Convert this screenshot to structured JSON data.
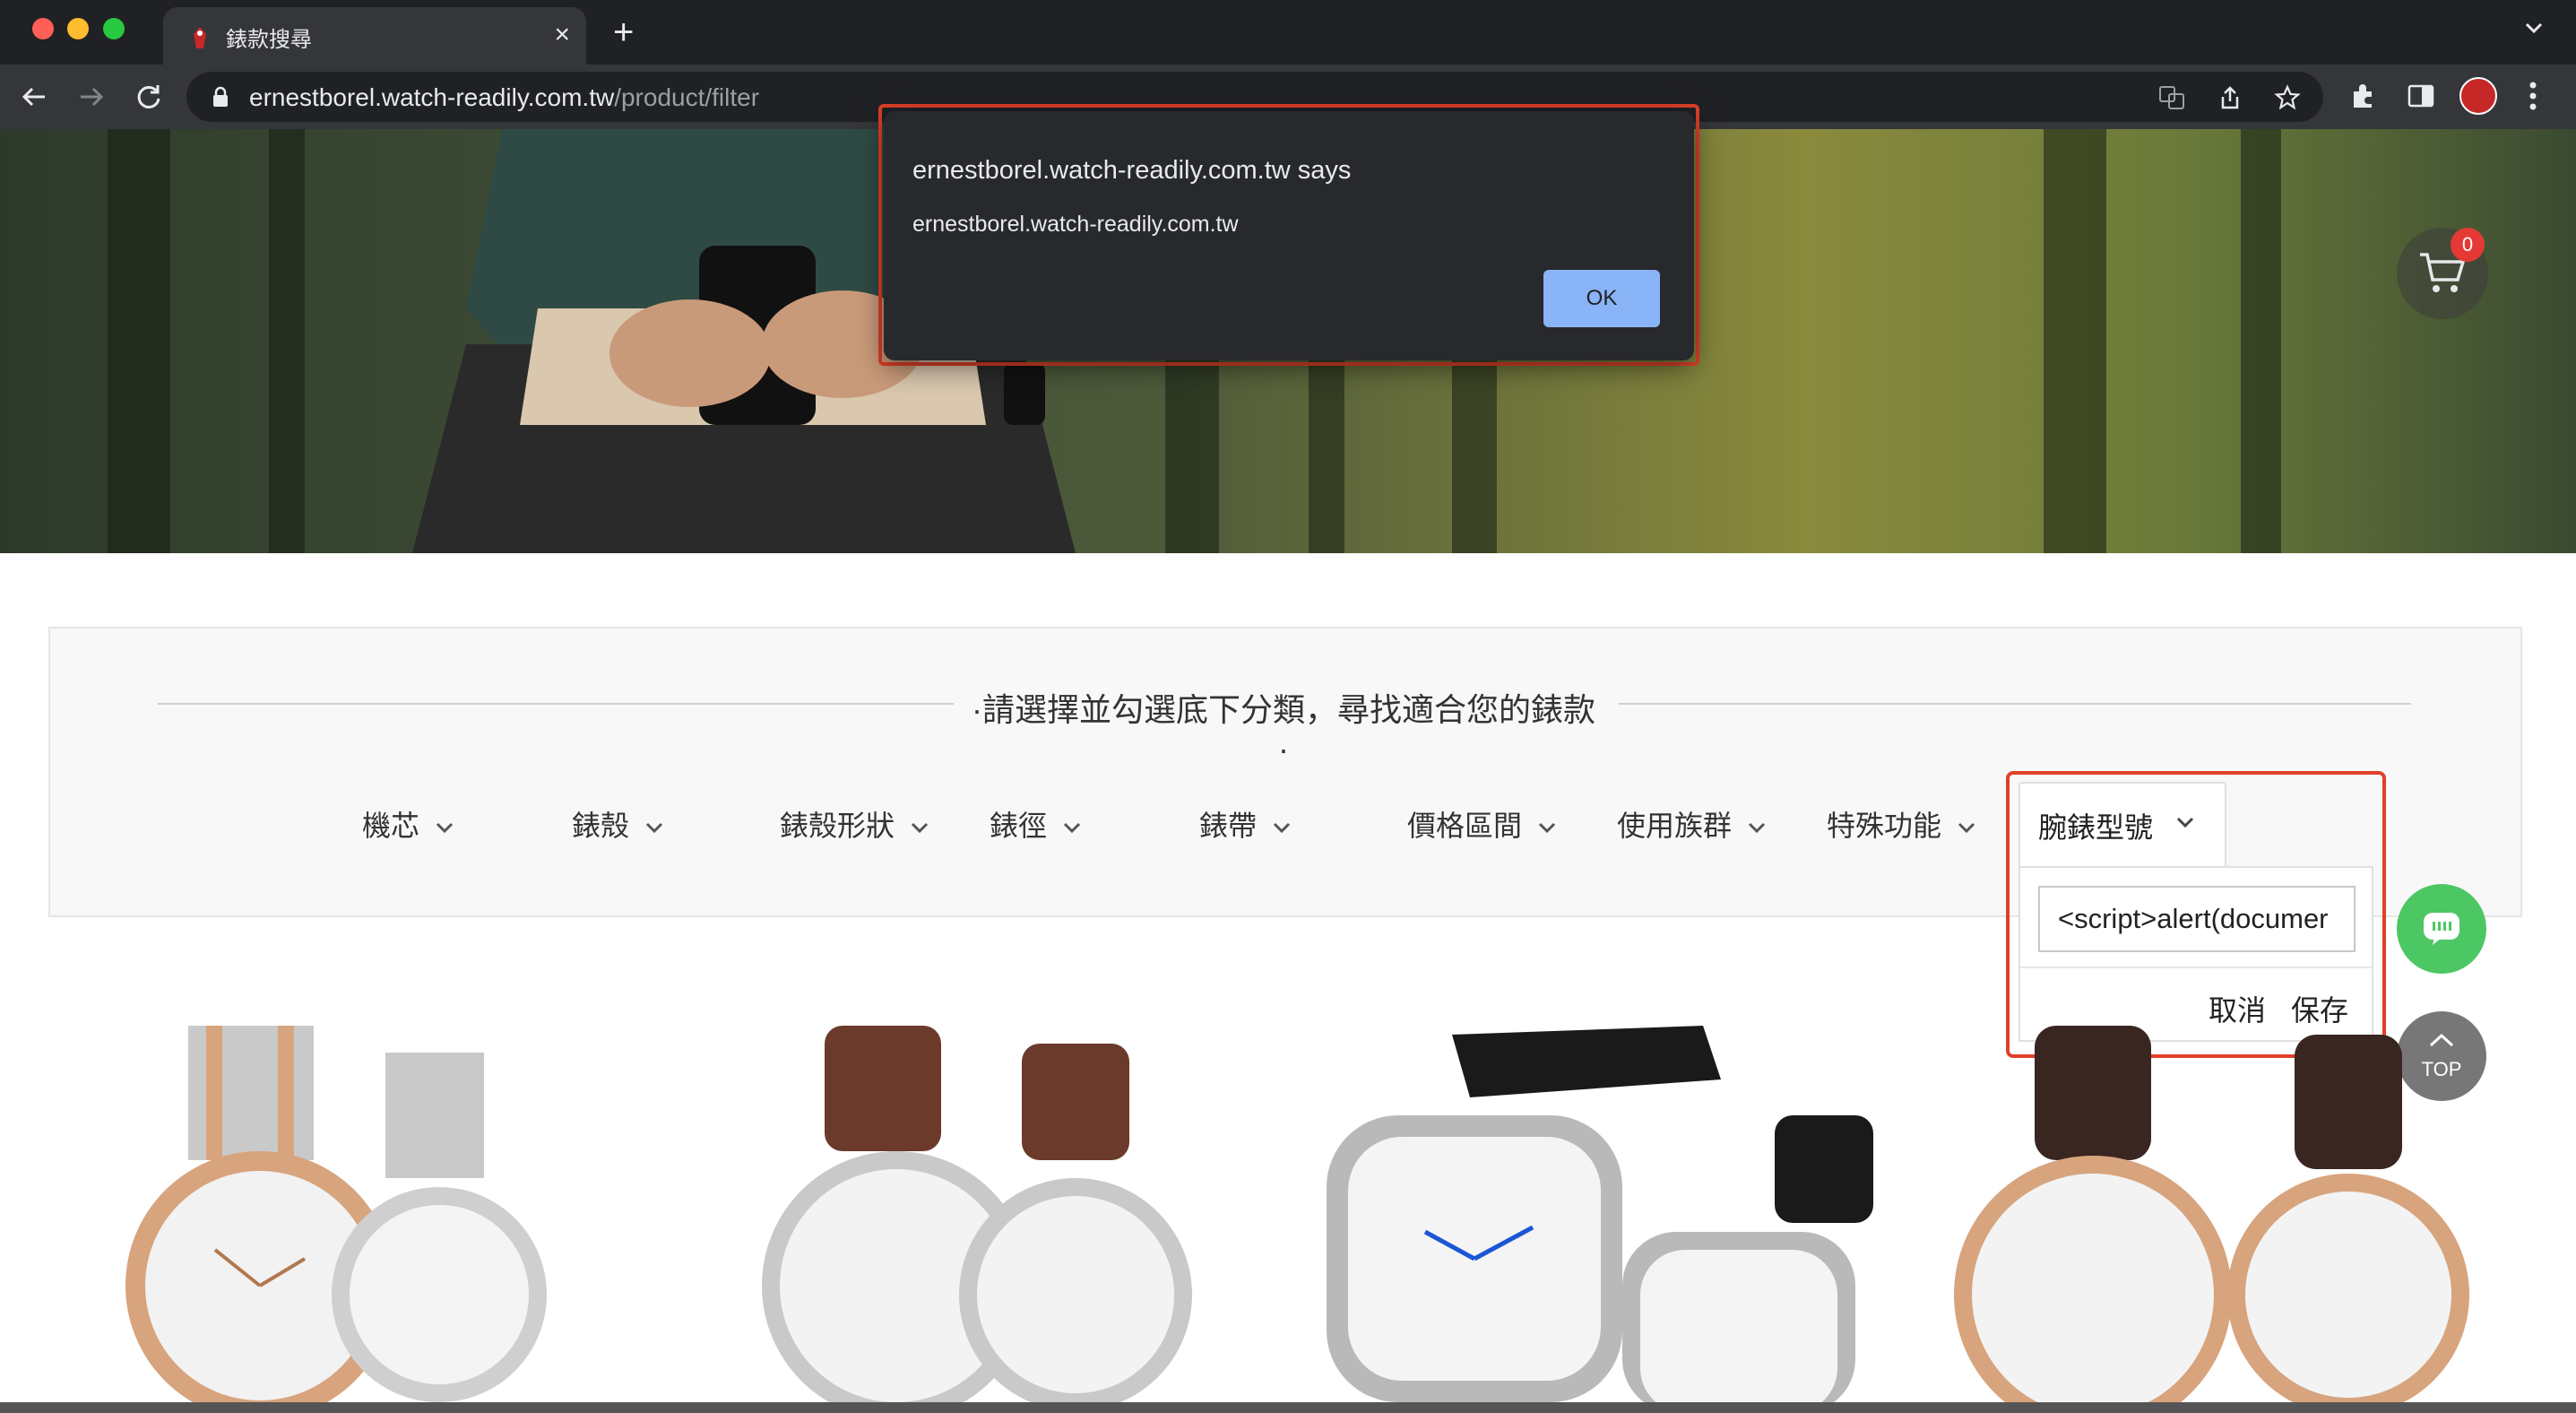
{
  "browser": {
    "tab_title": "錶款搜尋",
    "tab_close": "×",
    "new_tab": "+",
    "url_host": "ernestborel.watch-readily.com.tw",
    "url_path": "/product/filter"
  },
  "alert": {
    "title": "ernestborel.watch-readily.com.tw says",
    "message": "ernestborel.watch-readily.com.tw",
    "ok_label": "OK"
  },
  "cart": {
    "count": "0"
  },
  "filter": {
    "title": "·請選擇並勾選底下分類，尋找適合您的錶款·",
    "items": [
      {
        "label": "機芯"
      },
      {
        "label": "錶殼"
      },
      {
        "label": "錶殼形狀"
      },
      {
        "label": "錶徑"
      },
      {
        "label": "錶帶"
      },
      {
        "label": "價格區間"
      },
      {
        "label": "使用族群"
      },
      {
        "label": "特殊功能"
      }
    ],
    "model": {
      "label": "腕錶型號",
      "input_value": "<script>alert(documer",
      "cancel_label": "取消",
      "save_label": "保存"
    }
  },
  "floating": {
    "top_label": "TOP"
  },
  "colors": {
    "alert_bg": "#28292c",
    "ok_button": "#8ab4f8",
    "highlight_red": "#e0402a",
    "line_green": "#4cc764",
    "badge_red": "#e53935"
  }
}
